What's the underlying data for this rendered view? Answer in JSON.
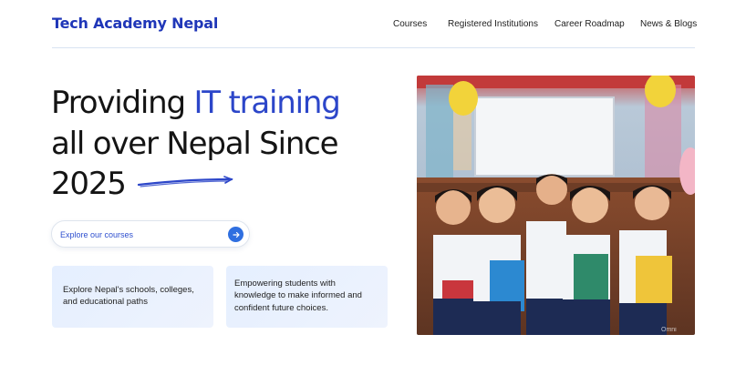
{
  "header": {
    "logo": "Tech Academy Nepal",
    "nav": [
      "Courses",
      "Registered Institutions",
      "Career Roadmap",
      "News & Blogs"
    ]
  },
  "hero": {
    "line1_pre": "Providing ",
    "line1_accent": "IT training",
    "line2": "all over Nepal Since",
    "line3": "2025",
    "accent_color": "#2c46c9"
  },
  "search": {
    "label": "Explore our courses",
    "button_icon": "arrow-right-icon"
  },
  "cards": [
    {
      "text": "Explore Nepal's schools, colleges, and educational paths"
    },
    {
      "text": "Empowering students with knowledge to make informed and confident future choices."
    }
  ],
  "photo": {
    "watermark": "Omni"
  }
}
